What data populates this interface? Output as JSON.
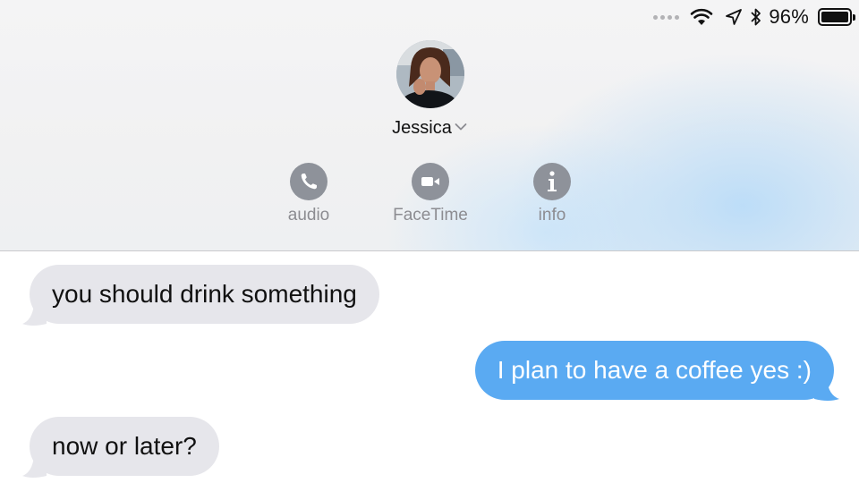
{
  "status_bar": {
    "battery_percent": "96%",
    "icons": [
      "signal-dots-icon",
      "wifi-icon",
      "location-arrow-icon",
      "bluetooth-icon",
      "battery-icon"
    ]
  },
  "contact": {
    "name": "Jessica",
    "avatar": "contact-photo"
  },
  "actions": [
    {
      "label": "audio",
      "icon": "phone-icon"
    },
    {
      "label": "FaceTime",
      "icon": "video-camera-icon"
    },
    {
      "label": "info",
      "icon": "info-icon"
    }
  ],
  "messages": [
    {
      "direction": "incoming",
      "text": "you should drink something"
    },
    {
      "direction": "outgoing",
      "text": "I plan to have a coffee yes :)"
    },
    {
      "direction": "incoming",
      "text": "now or later?"
    }
  ],
  "colors": {
    "incoming_bubble": "#e6e6eb",
    "outgoing_bubble": "#5aaaf2",
    "action_icon": "#8e929a"
  }
}
